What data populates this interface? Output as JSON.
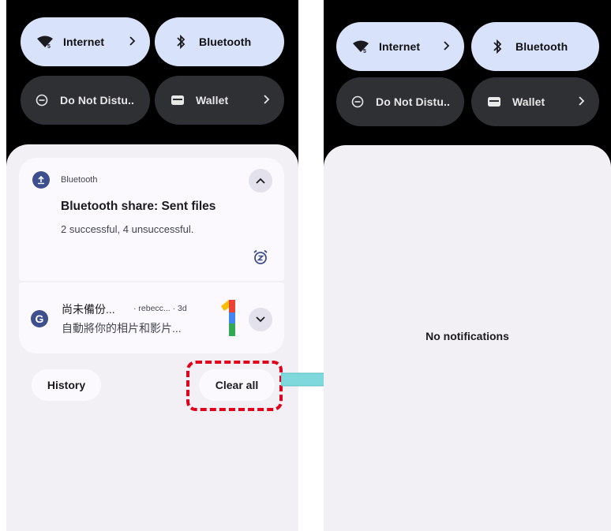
{
  "left": {
    "tiles": {
      "internet": "Internet",
      "bluetooth": "Bluetooth",
      "dnd": "Do Not Distu..",
      "wallet": "Wallet"
    },
    "notifications": [
      {
        "app": "Bluetooth",
        "title": "Bluetooth share: Sent files",
        "text": "2 successful, 4 unsuccessful."
      },
      {
        "app_letter": "G",
        "title": "尚未備份...",
        "meta": "· rebecc... · 3d",
        "text": "自動將你的相片和影片..."
      }
    ],
    "history_label": "History",
    "clear_all_label": "Clear all"
  },
  "right": {
    "tiles": {
      "internet": "Internet",
      "bluetooth": "Bluetooth",
      "dnd": "Do Not Distu..",
      "wallet": "Wallet"
    },
    "empty_message": "No notifications"
  },
  "colors": {
    "tile_active": "#d8e2fb",
    "tile_inactive": "#2f3033",
    "highlight_border": "#e0001b",
    "arrow": "#7fd9dc"
  }
}
